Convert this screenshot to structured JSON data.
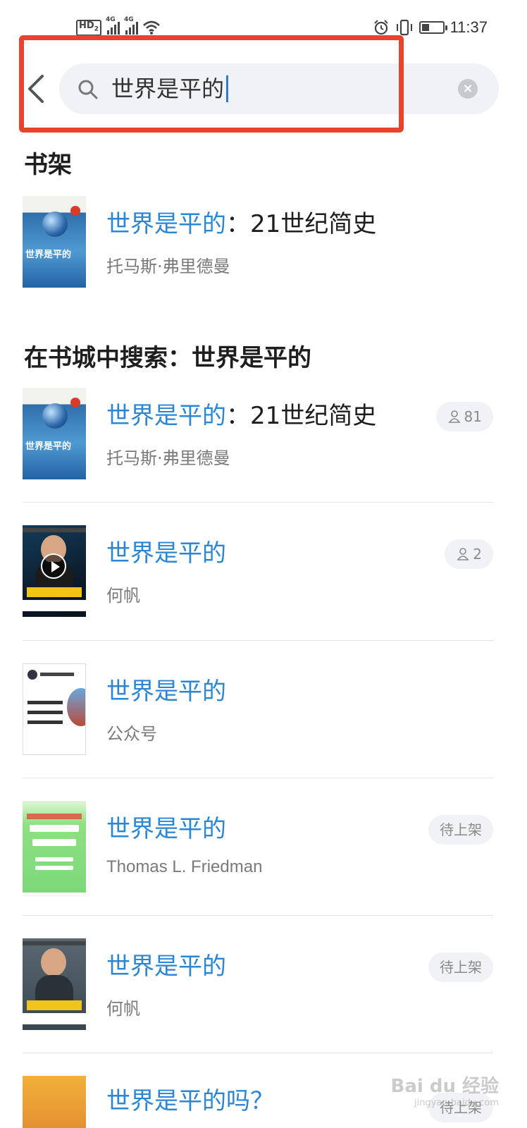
{
  "status_bar": {
    "network_labels": [
      "HD",
      "2",
      "4G",
      "4G"
    ],
    "time": "11:37",
    "icons": [
      "signal-icon",
      "wifi-icon",
      "alarm-icon",
      "vibrate-icon",
      "battery-icon"
    ]
  },
  "search": {
    "query": "世界是平的",
    "back_icon": "chevron-left-icon",
    "search_icon": "search-icon",
    "clear_icon": "clear-icon",
    "highlight_color": "#e7442e"
  },
  "sections": {
    "bookshelf_title": "书架",
    "store_title": "在书城中搜索：世界是平的"
  },
  "bookshelf": [
    {
      "title_highlight": "世界是平的",
      "title_rest": "：21世纪简史",
      "author": "托马斯·弗里德曼"
    }
  ],
  "store_results": [
    {
      "title_highlight": "世界是平的",
      "title_rest": "：21世纪简史",
      "author": "托马斯·弗里德曼",
      "tag": "81",
      "tag_icon": "reader-icon"
    },
    {
      "title_highlight": "世界是平的",
      "title_rest": "",
      "author": "何帆",
      "tag": "2",
      "tag_icon": "reader-icon"
    },
    {
      "title_highlight": "世界是平的",
      "title_rest": "",
      "author": "公众号",
      "tag": ""
    },
    {
      "title_highlight": "世界是平的",
      "title_rest": "",
      "author": "Thomas L. Friedman",
      "tag": "待上架"
    },
    {
      "title_highlight": "世界是平的",
      "title_rest": "",
      "author": "何帆",
      "tag": "待上架"
    },
    {
      "title_highlight": "世界是平的",
      "title_rest": "吗？",
      "author": "",
      "tag": "待上架"
    }
  ],
  "watermark": {
    "text": "Bai du 经验",
    "sub": "jingyan.baidu.com"
  },
  "colors": {
    "highlight_title": "#2b86d4",
    "tag_bg": "#f1f2f5",
    "caret": "#2b7ad6"
  }
}
